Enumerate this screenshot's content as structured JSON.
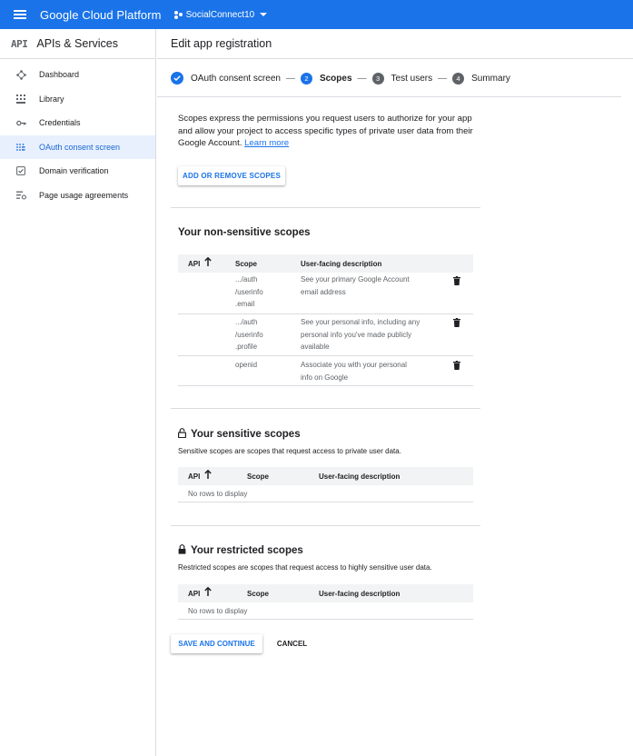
{
  "topbar": {
    "brand": "Google Cloud Platform",
    "project": "SocialConnect10",
    "color": "#1a73e8"
  },
  "sidebar": {
    "logo": "API",
    "title": "APIs & Services",
    "items": [
      {
        "label": "Dashboard",
        "icon": "dashboard-icon"
      },
      {
        "label": "Library",
        "icon": "library-icon"
      },
      {
        "label": "Credentials",
        "icon": "key-icon"
      },
      {
        "label": "OAuth consent screen",
        "icon": "oauth-icon",
        "active": true
      },
      {
        "label": "Domain verification",
        "icon": "domain-check-icon"
      },
      {
        "label": "Page usage agreements",
        "icon": "settings-list-icon"
      }
    ]
  },
  "main": {
    "title": "Edit app registration"
  },
  "stepper": {
    "steps": [
      {
        "num": "",
        "label": "OAuth consent screen",
        "state": "done"
      },
      {
        "num": "2",
        "label": "Scopes",
        "state": "current"
      },
      {
        "num": "3",
        "label": "Test users",
        "state": "pending"
      },
      {
        "num": "4",
        "label": "Summary",
        "state": "pending"
      }
    ],
    "separator": "—"
  },
  "intro": {
    "text": "Scopes express the permissions you request users to authorize for your app and allow your project to access specific types of private user data from their Google Account.",
    "link": "Learn more"
  },
  "add_scopes_button": "ADD OR REMOVE SCOPES",
  "non_sensitive": {
    "title": "Your non-sensitive scopes",
    "headers": {
      "api": "API",
      "scope": "Scope",
      "desc": "User-facing description",
      "sort_arrow": "🡑"
    },
    "rows": [
      {
        "scope": [
          ".../auth",
          "/userinfo",
          ".email"
        ],
        "desc": [
          "See your primary Google Account",
          "email address"
        ]
      },
      {
        "scope": [
          ".../auth",
          "/userinfo",
          ".profile"
        ],
        "desc": [
          "See your personal info, including any",
          "personal info you've made publicly",
          "available"
        ]
      },
      {
        "scope": [
          "openid"
        ],
        "desc": [
          "Associate you with your personal",
          "info on Google"
        ]
      }
    ]
  },
  "sensitive": {
    "title": "Your sensitive scopes",
    "desc": "Sensitive scopes are scopes that request access to private user data.",
    "headers": {
      "api": "API",
      "scope": "Scope",
      "desc": "User-facing description"
    },
    "empty": "No rows to display"
  },
  "restricted": {
    "title": "Your restricted scopes",
    "desc": "Restricted scopes are scopes that request access to highly sensitive user data.",
    "headers": {
      "api": "API",
      "scope": "Scope",
      "desc": "User-facing description"
    },
    "empty": "No rows to display"
  },
  "actions": {
    "save": "SAVE AND CONTINUE",
    "cancel": "CANCEL"
  }
}
